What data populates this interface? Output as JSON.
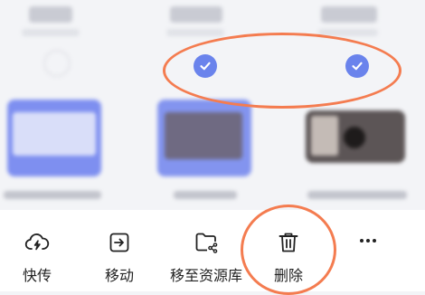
{
  "toolbar": {
    "items": [
      {
        "label": "快传",
        "icon": "cloud-upload-icon"
      },
      {
        "label": "移动",
        "icon": "move-icon"
      },
      {
        "label": "移至资源库",
        "icon": "folder-share-icon"
      },
      {
        "label": "删除",
        "icon": "trash-icon"
      },
      {
        "label": "",
        "icon": "more-icon"
      }
    ]
  },
  "selection": {
    "checked_items": 2
  },
  "colors": {
    "accent": "#6a83ec",
    "annotation": "#f47c50",
    "background": "#f3f4f7",
    "toolbar_bg": "#ffffff"
  }
}
